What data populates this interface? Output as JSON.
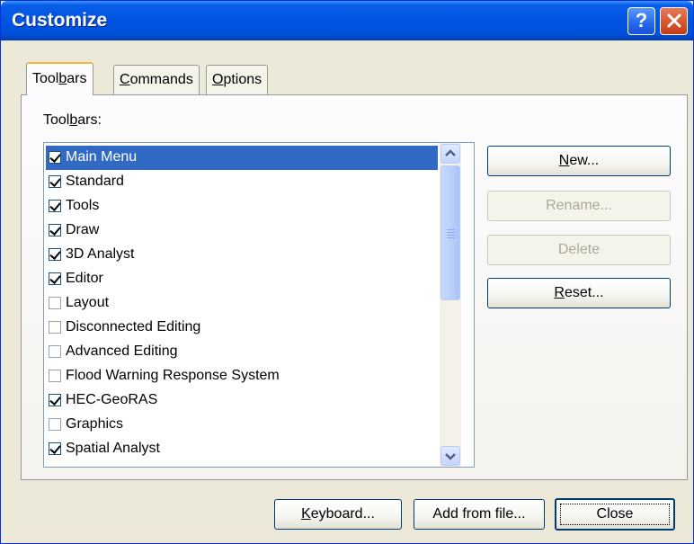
{
  "window": {
    "title": "Customize"
  },
  "tabs": [
    {
      "pre": "Tool",
      "u": "b",
      "post": "ars"
    },
    {
      "pre": "",
      "u": "C",
      "post": "ommands"
    },
    {
      "pre": "",
      "u": "O",
      "post": "ptions"
    }
  ],
  "panel": {
    "list_label_pre": "Tool",
    "list_label_u": "b",
    "list_label_post": "ars:"
  },
  "toolbars": [
    {
      "label": "Main Menu",
      "checked": true,
      "selected": true
    },
    {
      "label": "Standard",
      "checked": true
    },
    {
      "label": "Tools",
      "checked": true
    },
    {
      "label": "Draw",
      "checked": true
    },
    {
      "label": "3D Analyst",
      "checked": true
    },
    {
      "label": "Editor",
      "checked": true
    },
    {
      "label": "Layout",
      "checked": false
    },
    {
      "label": "Disconnected Editing",
      "checked": false
    },
    {
      "label": "Advanced Editing",
      "checked": false
    },
    {
      "label": "Flood Warning Response System",
      "checked": false
    },
    {
      "label": "HEC-GeoRAS",
      "checked": true
    },
    {
      "label": "Graphics",
      "checked": false
    },
    {
      "label": "Spatial Analyst",
      "checked": true
    }
  ],
  "side_buttons": {
    "new": {
      "u": "N",
      "post": "ew..."
    },
    "rename": "Rename...",
    "delete": "Delete",
    "reset": {
      "u": "R",
      "post": "eset..."
    }
  },
  "bottom_buttons": {
    "keyboard": {
      "u": "K",
      "post": "eyboard..."
    },
    "add_from_file": "Add from file...",
    "close": "Close"
  },
  "colors": {
    "titlebar": "#0054e3",
    "selection": "#316ac5",
    "close_button": "#d4542c"
  }
}
